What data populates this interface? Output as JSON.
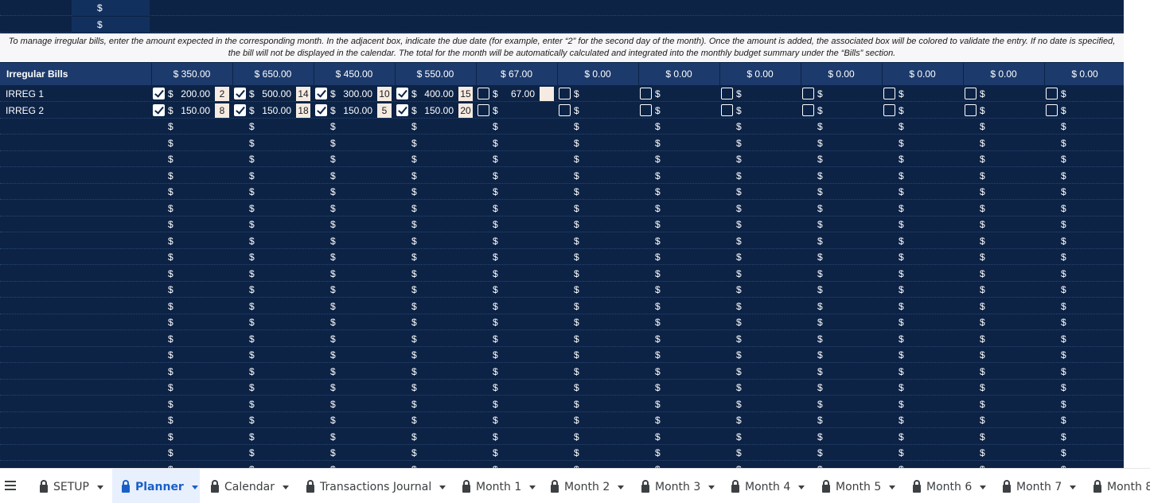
{
  "top_rows": [
    "$",
    "$"
  ],
  "note": "To manage irregular bills, enter the amount expected in the corresponding month. In the adjacent box, indicate the due date (for example, enter “2” for the second day of the month). Once the amount is added, the associated box will be colored to validate the entry. If no date is specified, the bill will not be displayed in the calendar. The total for the month will be automatically calculated and integrated into the monthly budget summary under the “Bills” section.",
  "header": {
    "title": "Irregular Bills",
    "totals": [
      "$  350.00",
      "$  650.00",
      "$  450.00",
      "$  550.00",
      "$  67.00",
      "$  0.00",
      "$  0.00",
      "$  0.00",
      "$  0.00",
      "$  0.00",
      "$  0.00",
      "$  0.00"
    ]
  },
  "currency_symbol": "$",
  "bills": [
    {
      "name": "IRREG 1",
      "months": [
        {
          "checked": true,
          "amount": "200.00",
          "day": "2"
        },
        {
          "checked": true,
          "amount": "500.00",
          "day": "14"
        },
        {
          "checked": true,
          "amount": "300.00",
          "day": "10"
        },
        {
          "checked": true,
          "amount": "400.00",
          "day": "15"
        },
        {
          "checked": false,
          "amount": "67.00",
          "day": ""
        },
        {
          "checked": false,
          "amount": "",
          "day": ""
        },
        {
          "checked": false,
          "amount": "",
          "day": ""
        },
        {
          "checked": false,
          "amount": "",
          "day": ""
        },
        {
          "checked": false,
          "amount": "",
          "day": ""
        },
        {
          "checked": false,
          "amount": "",
          "day": ""
        },
        {
          "checked": false,
          "amount": "",
          "day": ""
        },
        {
          "checked": false,
          "amount": "",
          "day": ""
        }
      ]
    },
    {
      "name": "IRREG 2",
      "months": [
        {
          "checked": true,
          "amount": "150.00",
          "day": "8"
        },
        {
          "checked": true,
          "amount": "150.00",
          "day": "18"
        },
        {
          "checked": true,
          "amount": "150.00",
          "day": "5"
        },
        {
          "checked": true,
          "amount": "150.00",
          "day": "20"
        },
        {
          "checked": false,
          "amount": "",
          "day": ""
        },
        {
          "checked": false,
          "amount": "",
          "day": ""
        },
        {
          "checked": false,
          "amount": "",
          "day": ""
        },
        {
          "checked": false,
          "amount": "",
          "day": ""
        },
        {
          "checked": false,
          "amount": "",
          "day": ""
        },
        {
          "checked": false,
          "amount": "",
          "day": ""
        },
        {
          "checked": false,
          "amount": "",
          "day": ""
        },
        {
          "checked": false,
          "amount": "",
          "day": ""
        }
      ]
    }
  ],
  "empty_rows": 22,
  "tabs": [
    {
      "label": "SETUP",
      "locked": true,
      "active": false
    },
    {
      "label": "Planner",
      "locked": true,
      "active": true
    },
    {
      "label": "Calendar",
      "locked": true,
      "active": false
    },
    {
      "label": "Transactions Journal",
      "locked": true,
      "active": false
    },
    {
      "label": "Month 1",
      "locked": true,
      "active": false
    },
    {
      "label": "Month 2",
      "locked": true,
      "active": false
    },
    {
      "label": "Month 3",
      "locked": true,
      "active": false
    },
    {
      "label": "Month 4",
      "locked": true,
      "active": false
    },
    {
      "label": "Month 5",
      "locked": true,
      "active": false
    },
    {
      "label": "Month 6",
      "locked": true,
      "active": false
    },
    {
      "label": "Month 7",
      "locked": true,
      "active": false
    },
    {
      "label": "Month 8",
      "locked": true,
      "active": false
    }
  ],
  "colors": {
    "sheet_bg": "#0c2346",
    "header_bg": "#1c3a6b",
    "day_box": "#f5ebe2",
    "active_tab": "#1a5fc7"
  }
}
